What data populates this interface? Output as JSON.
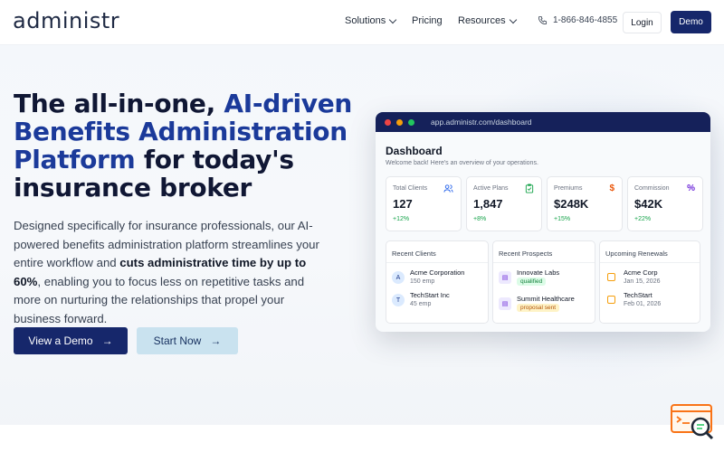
{
  "brand": {
    "logo": "administr"
  },
  "nav": {
    "solutions": "Solutions",
    "pricing": "Pricing",
    "resources": "Resources",
    "phone": "1-866-846-4855",
    "login": "Login",
    "demo": "Demo"
  },
  "hero": {
    "title_part1": "The all-in-one, ",
    "title_accent": "AI-driven Benefits Administration Platform",
    "title_part2": " for today's insurance broker",
    "desc_part1": "Designed specifically for insurance professionals, our AI-powered benefits administration platform streamlines your entire workflow and ",
    "desc_bold": "cuts administrative time by up to 60%",
    "desc_part2": ", enabling you to focus less on repetitive tasks and more on nurturing the relationships that propel your business forward.",
    "cta_primary": "View a Demo",
    "cta_secondary": "Start Now"
  },
  "dashboard": {
    "url": "app.administr.com/dashboard",
    "title": "Dashboard",
    "subtitle": "Welcome back! Here's an overview of your operations.",
    "stats": [
      {
        "label": "Total Clients",
        "value": "127",
        "delta": "+12%",
        "icon": "users-icon",
        "color": "#2563eb"
      },
      {
        "label": "Active Plans",
        "value": "1,847",
        "delta": "+8%",
        "icon": "clipboard-icon",
        "color": "#16a34a"
      },
      {
        "label": "Premiums",
        "value": "$248K",
        "delta": "+15%",
        "icon": "dollar-icon",
        "color": "#ea580c"
      },
      {
        "label": "Commission",
        "value": "$42K",
        "delta": "+22%",
        "icon": "percent-icon",
        "color": "#6d28d9"
      }
    ],
    "recent_clients": {
      "title": "Recent Clients",
      "items": [
        {
          "initial": "A",
          "name": "Acme Corporation",
          "meta": "150 emp"
        },
        {
          "initial": "T",
          "name": "TechStart Inc",
          "meta": "45 emp"
        }
      ]
    },
    "recent_prospects": {
      "title": "Recent Prospects",
      "items": [
        {
          "name": "Innovate Labs",
          "status": "qualified"
        },
        {
          "name": "Summit Healthcare",
          "status": "proposal sent"
        }
      ]
    },
    "upcoming_renewals": {
      "title": "Upcoming Renewals",
      "items": [
        {
          "name": "Acme Corp",
          "date": "Jan 15, 2026"
        },
        {
          "name": "TechStart",
          "date": "Feb 01, 2026"
        }
      ]
    }
  },
  "colors": {
    "primary": "#16276b",
    "accent_text": "#1b3a9a",
    "secondary_button": "#c9e2ef",
    "dash_bar": "#15215a"
  }
}
